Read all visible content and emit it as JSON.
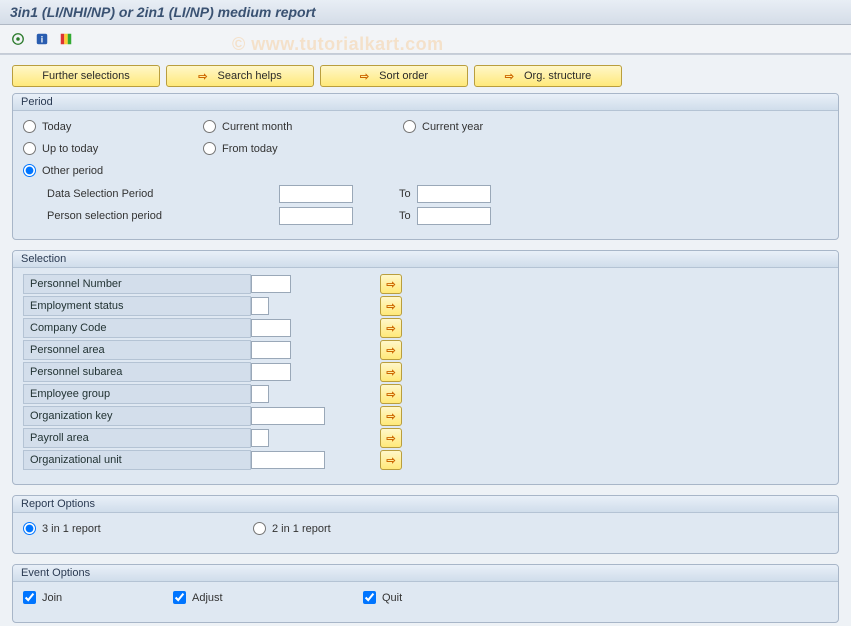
{
  "title": "3in1 (LI/NHI/NP) or 2in1 (LI/NP) medium report",
  "watermark": "© www.tutorialkart.com",
  "toolbar_buttons": {
    "further_selections": "Further selections",
    "search_helps": "Search helps",
    "sort_order": "Sort order",
    "org_structure": "Org. structure"
  },
  "period": {
    "header": "Period",
    "options": {
      "today": "Today",
      "up_to_today": "Up to today",
      "other_period": "Other period",
      "current_month": "Current month",
      "from_today": "From today",
      "current_year": "Current year"
    },
    "selected": "other_period",
    "data_sel_label": "Data Selection Period",
    "person_sel_label": "Person selection period",
    "to_label": "To",
    "data_from": "",
    "data_to": "",
    "person_from": "",
    "person_to": ""
  },
  "selection": {
    "header": "Selection",
    "fields": [
      {
        "label": "Personnel Number",
        "width": "md",
        "value": ""
      },
      {
        "label": "Employment status",
        "width": "sm",
        "value": ""
      },
      {
        "label": "Company Code",
        "width": "md",
        "value": ""
      },
      {
        "label": "Personnel area",
        "width": "md",
        "value": ""
      },
      {
        "label": "Personnel subarea",
        "width": "md",
        "value": ""
      },
      {
        "label": "Employee group",
        "width": "sm",
        "value": ""
      },
      {
        "label": "Organization key",
        "width": "lg",
        "value": ""
      },
      {
        "label": "Payroll area",
        "width": "sm",
        "value": ""
      },
      {
        "label": "Organizational unit",
        "width": "lg",
        "value": ""
      }
    ]
  },
  "report_options": {
    "header": "Report Options",
    "opt1": "3 in 1 report",
    "opt2": "2 in 1 report",
    "selected": "opt1"
  },
  "event_options": {
    "header": "Event Options",
    "join": "Join",
    "adjust": "Adjust",
    "quit": "Quit",
    "join_checked": true,
    "adjust_checked": true,
    "quit_checked": true
  }
}
